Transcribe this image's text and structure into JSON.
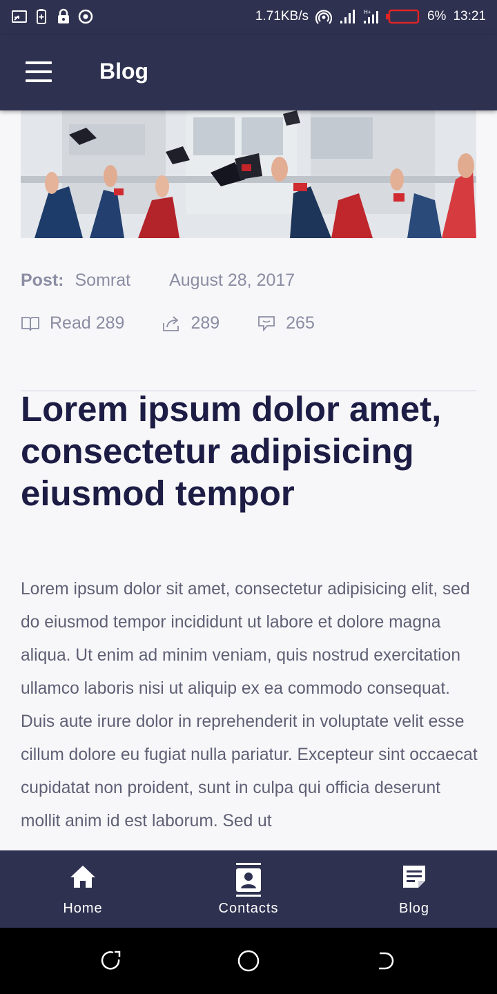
{
  "status_bar": {
    "net_speed": "1.71KB/s",
    "battery_pct": "6%",
    "time": "13:21",
    "icons": [
      "screen-cast-icon",
      "battery-saver-icon",
      "lock-icon",
      "target-icon",
      "hotspot-icon",
      "signal-icon",
      "signal-ht-icon",
      "battery-low-icon"
    ],
    "battery_color": "#e02424"
  },
  "app_bar": {
    "title": "Blog",
    "menu_icon": "hamburger-icon"
  },
  "post": {
    "meta": {
      "post_label": "Post:",
      "author": "Somrat",
      "date": "August 28, 2017"
    },
    "stats": {
      "read_label": "Read 289",
      "shares": "289",
      "comments": "265"
    },
    "title": "Lorem ipsum dolor amet, consectetur adipisicing eiusmod tempor",
    "body": "Lorem ipsum dolor sit amet, consectetur adipisicing elit, sed do eiusmod tempor incididunt ut labore et dolore magna aliqua. Ut enim ad minim veniam, quis nostrud exercitation ullamco laboris nisi ut aliquip ex ea commodo consequat. Duis aute irure dolor in reprehenderit in voluptate velit esse cillum dolore eu fugiat nulla pariatur. Excepteur sint occaecat cupidatat non proident, sunt in culpa qui officia deserunt mollit anim id est laborum. Sed ut"
  },
  "bottom_nav": {
    "items": [
      {
        "label": "Home",
        "icon": "home-icon"
      },
      {
        "label": "Contacts",
        "icon": "contacts-icon"
      },
      {
        "label": "Blog",
        "icon": "blog-icon"
      }
    ]
  },
  "colors": {
    "primary_dark": "#2f3150",
    "title_text": "#1c1c45",
    "meta_text": "#8b8da3",
    "body_text": "#5f6075",
    "page_bg": "#f7f7f9"
  }
}
